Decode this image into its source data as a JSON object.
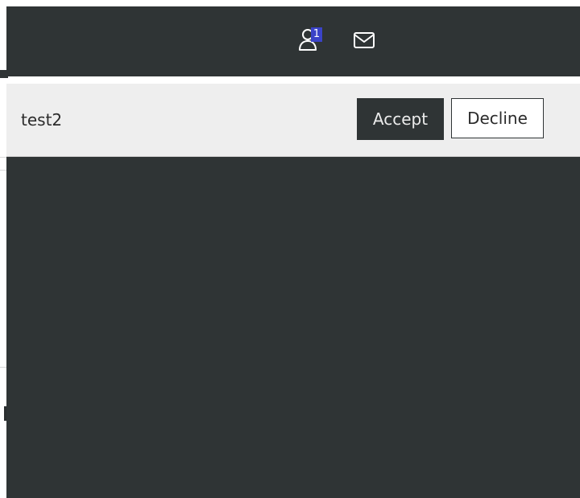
{
  "topbar": {
    "friends_icon": "friends-user-icon",
    "friends_badge": "1",
    "mail_icon": "envelope-icon",
    "badge_color": "#3b43c8",
    "bar_color": "#2f3435"
  },
  "friend_request": {
    "username": "test2",
    "accept_label": "Accept",
    "decline_label": "Decline"
  }
}
